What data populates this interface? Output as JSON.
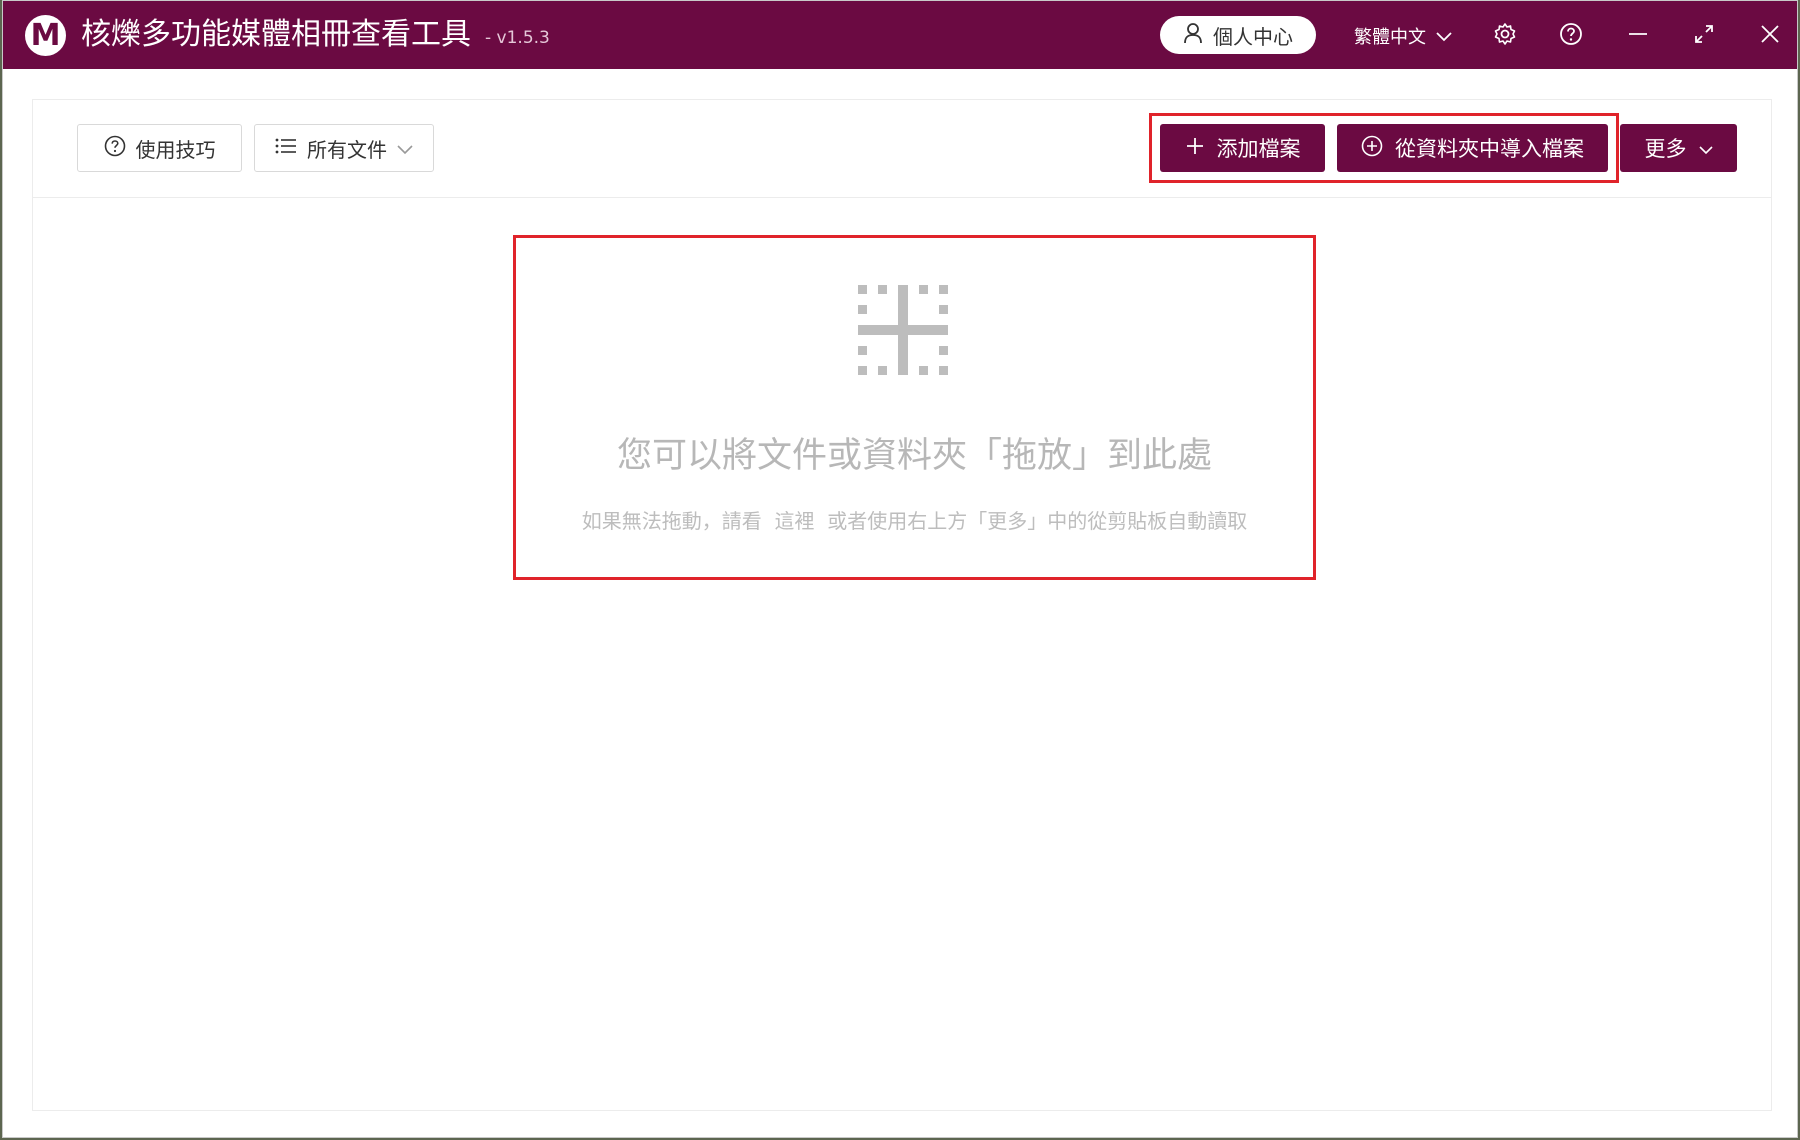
{
  "window": {
    "logo_letter": "M",
    "title": "核爍多功能媒體相冊查看工具",
    "version": "- v1.5.3",
    "user_center_label": "個人中心",
    "language_label": "繁體中文"
  },
  "toolbar": {
    "tips_label": "使用技巧",
    "filter_label": "所有文件",
    "add_file_label": "添加檔案",
    "import_folder_label": "從資料夾中導入檔案",
    "more_label": "更多"
  },
  "drop_zone": {
    "title": "您可以將文件或資料夾「拖放」到此處",
    "hint_before": "如果無法拖動，請看",
    "hint_link": "這裡",
    "hint_after": "或者使用右上方「更多」中的從剪貼板自動讀取"
  },
  "colors": {
    "brand": "#6b0a42",
    "highlight": "#e0232a",
    "placeholder_text": "#b7b7b7"
  },
  "icons": [
    "user-icon",
    "chevron-down-icon",
    "gear-icon",
    "help-icon",
    "minimize-icon",
    "maximize-icon",
    "close-icon",
    "question-circle-icon",
    "list-icon",
    "plus-icon",
    "plus-circle-icon",
    "drop-target-icon"
  ]
}
